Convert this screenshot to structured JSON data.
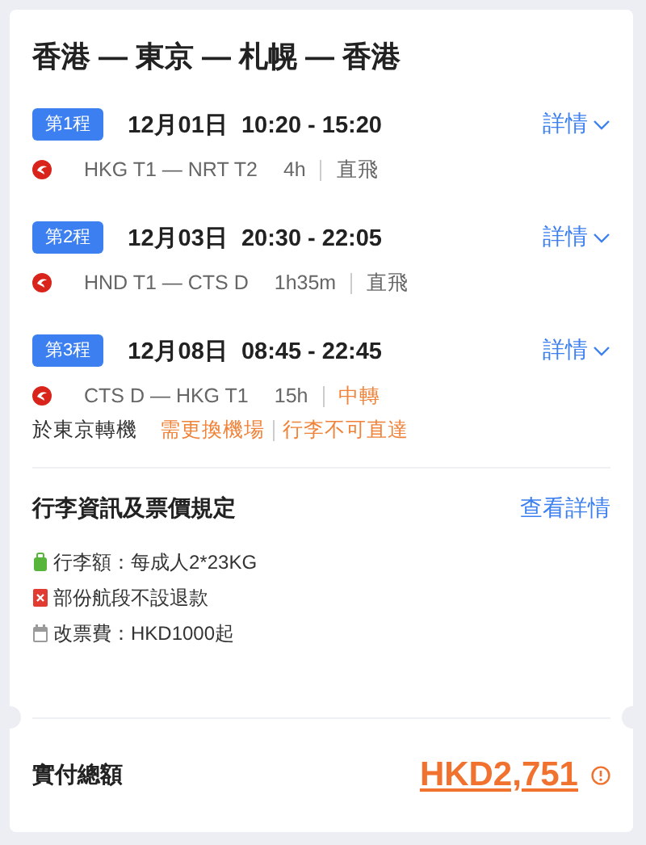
{
  "title": "香港 — 東京 — 札幌 — 香港",
  "legs": [
    {
      "badge": "第1程",
      "schedule": "12月01日  10:20 - 15:20",
      "details": "詳情",
      "route": "HKG T1 — NRT T2",
      "duration": "4h",
      "stop": {
        "kind": "direct",
        "label": "直飛"
      }
    },
    {
      "badge": "第2程",
      "schedule": "12月03日  20:30 - 22:05",
      "details": "詳情",
      "route": "HND T1 — CTS D",
      "duration": "1h35m",
      "stop": {
        "kind": "direct",
        "label": "直飛"
      }
    },
    {
      "badge": "第3程",
      "schedule": "12月08日  08:45 - 22:45",
      "details": "詳情",
      "route": "CTS D — HKG T1",
      "duration": "15h",
      "stop": {
        "kind": "transfer",
        "label": "中轉"
      },
      "transfer_note": {
        "text": "於東京轉機",
        "warnings": [
          "需更換機場",
          "行李不可直達"
        ]
      }
    }
  ],
  "policy": {
    "title": "行李資訊及票價規定",
    "link": "查看詳情",
    "items": [
      {
        "kind": "baggage",
        "text": "行李額：每成人2*23KG"
      },
      {
        "kind": "refund",
        "text": "部份航段不設退款"
      },
      {
        "kind": "change",
        "text": "改票費：HKD1000起"
      }
    ]
  },
  "total": {
    "label": "實付總額",
    "amount": "HKD2,751"
  }
}
